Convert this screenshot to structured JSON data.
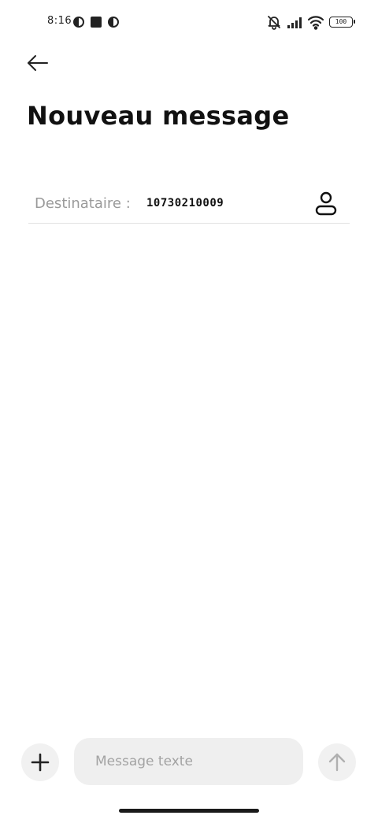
{
  "status_bar": {
    "time": "8:16",
    "battery_level": "100"
  },
  "header": {
    "title": "Nouveau message"
  },
  "recipient": {
    "label": "Destinataire :",
    "value": "10730210009"
  },
  "composer": {
    "placeholder": "Message texte"
  },
  "icons": {
    "back": "arrow-left-icon",
    "contact": "person-icon",
    "add": "plus-icon",
    "send": "arrow-up-icon"
  }
}
